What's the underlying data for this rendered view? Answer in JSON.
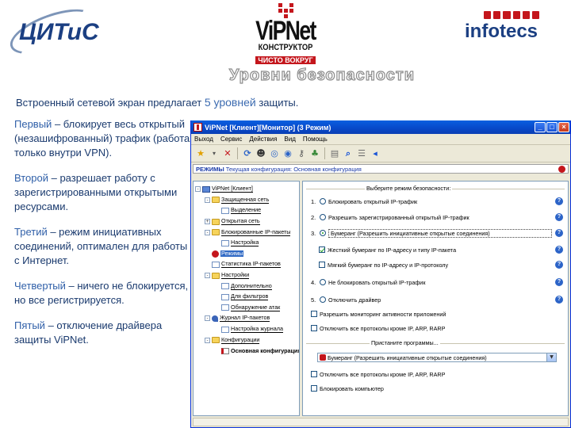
{
  "logos": {
    "left": "ЦИТиС",
    "center_main": "ViPNet",
    "center_sub1": "КОНСТРУКТОР",
    "center_sub2": "ЧИСТО ВОКРУГ",
    "right": "infotecs"
  },
  "slide": {
    "title": "Уровни безопасности",
    "intro_before": "Встроенный сетевой экран предлагает ",
    "intro_highlight": "5 уровней",
    "intro_after": " защиты.",
    "levels": [
      {
        "name": "Первый",
        "text": " – блокирует весь открытый (незашифрованный) трафик (работа только внутри VPN)."
      },
      {
        "name": "Второй",
        "text": " – разрешает работу с зарегистрированными открытыми ресурсами."
      },
      {
        "name": "Третий",
        "text": " – режим инициативных соединений, оптимален для работы с Интернет."
      },
      {
        "name": "Четвертый",
        "text": " – ничего не блокируется, но все регистрируется."
      },
      {
        "name": "Пятый",
        "text": " – отключение драйвера защиты ViPNet."
      }
    ]
  },
  "window": {
    "title": "ViPNet [Клиент][Монитор] (3 Режим)",
    "menu": [
      "Выход",
      "Сервис",
      "Действия",
      "Вид",
      "Помощь"
    ],
    "mode_label": "РЕЖИМЫ",
    "mode_value": "Текущая конфигурация: Основная конфигурация",
    "tree": [
      {
        "label": "ViPNet [Клиент]",
        "level": 0,
        "icon": "computer-icon",
        "pm": "-"
      },
      {
        "label": "Защищенная сеть",
        "level": 1,
        "icon": "folder-icon",
        "pm": "-"
      },
      {
        "label": "Выделение",
        "level": 2,
        "icon": "page-icon",
        "pm": ""
      },
      {
        "label": "Открытая сеть",
        "level": 1,
        "icon": "folder-icon",
        "pm": "+"
      },
      {
        "label": "Блокированные IP-пакеты",
        "level": 1,
        "icon": "folder-icon",
        "pm": "-"
      },
      {
        "label": "Настройка",
        "level": 2,
        "icon": "page-icon",
        "pm": ""
      },
      {
        "label": "Режимы",
        "level": 1,
        "icon": "shield-icon",
        "pm": "",
        "selected": true
      },
      {
        "label": "Статистика IP-пакетов",
        "level": 1,
        "icon": "page-icon",
        "pm": ""
      },
      {
        "label": "Настройки",
        "level": 1,
        "icon": "folder-icon",
        "pm": "-"
      },
      {
        "label": "Дополнительно",
        "level": 2,
        "icon": "page-icon",
        "pm": ""
      },
      {
        "label": "Для фильтров",
        "level": 2,
        "icon": "page-icon",
        "pm": ""
      },
      {
        "label": "Обнаружение атак",
        "level": 2,
        "icon": "page-icon",
        "pm": ""
      },
      {
        "label": "Журнал IP-пакетов",
        "level": 1,
        "icon": "pin-icon",
        "pm": "-"
      },
      {
        "label": "Настройка журнала",
        "level": 2,
        "icon": "page-icon",
        "pm": ""
      },
      {
        "label": "Конфигурации",
        "level": 1,
        "icon": "folder-icon",
        "pm": "-"
      },
      {
        "label": "Основная конфигурация",
        "level": 2,
        "icon": "book-icon",
        "pm": "",
        "bold": true
      }
    ],
    "security_legend": "Выберите режим безопасности:",
    "modes": [
      {
        "num": "1.",
        "label": "Блокировать открытый IP-трафик",
        "selected": false
      },
      {
        "num": "2.",
        "label": "Разрешить зарегистрированный открытый IP-трафик",
        "selected": false
      },
      {
        "num": "3.",
        "label": "Бумеранг (Разрешить инициативные открытые соединения)",
        "selected": true
      },
      {
        "num": "4.",
        "label": "Не блокировать открытый IP-трафик",
        "selected": false
      },
      {
        "num": "5.",
        "label": "Отключить драйвер",
        "selected": false
      }
    ],
    "suboptions": [
      {
        "label": "Жесткий бумеранг по IP-адресу и типу IP-пакета",
        "checked": true
      },
      {
        "label": "Мягкий бумеранг по IP-адресу и IP-протоколу",
        "checked": false
      }
    ],
    "checks_mid": [
      {
        "label": "Разрешить мониторинг активности приложений",
        "checked": false
      },
      {
        "label": "Отключить все протоколы кроме IP, ARP, RARP",
        "checked": false
      }
    ],
    "apps_legend": "Пристаните программы...",
    "combo_value": "Бумеранг (Разрешить инициативные открытые соединения)",
    "checks_bottom": [
      {
        "label": "Отключить все протоколы кроме IP, ARP, RARP",
        "checked": false
      },
      {
        "label": "Блокировать компьютер",
        "checked": false
      }
    ]
  },
  "colors": {
    "text_dark": "#1a3a6e",
    "text_accent": "#2f5fa8",
    "brand_red": "#c4161c",
    "xp_title_blue": "#0848c8"
  }
}
